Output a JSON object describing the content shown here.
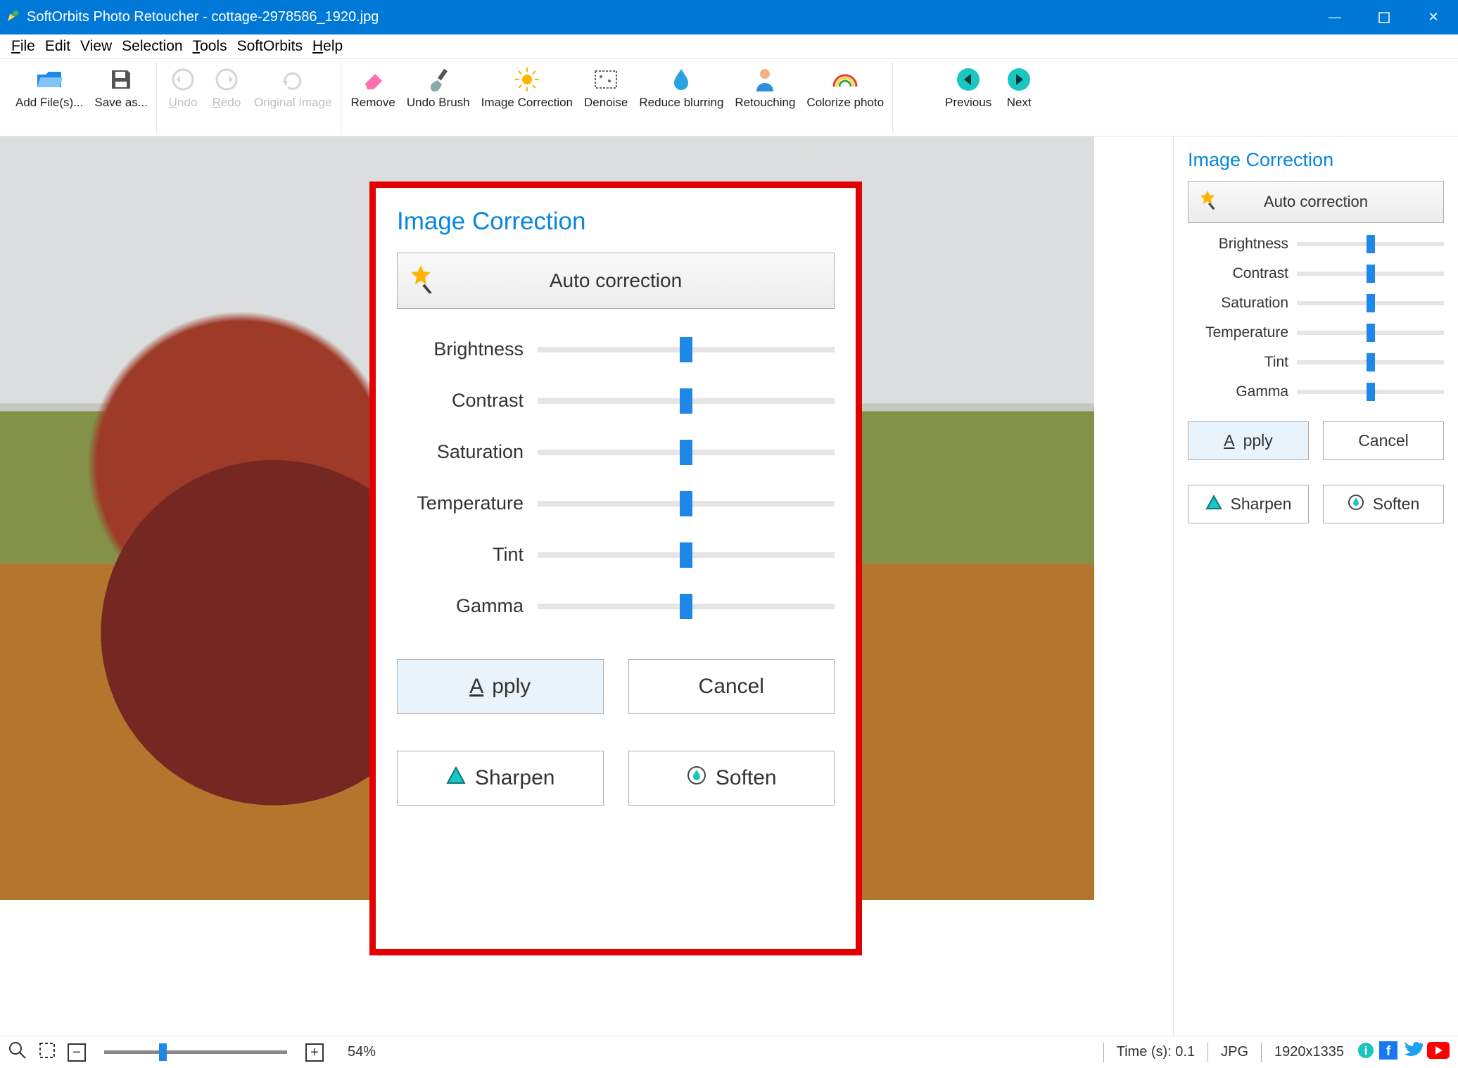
{
  "titlebar": {
    "app": "SoftOrbits Photo Retoucher",
    "file": "cottage-2978586_1920.jpg"
  },
  "menu": {
    "file": "File",
    "edit": "Edit",
    "view": "View",
    "selection": "Selection",
    "tools": "Tools",
    "softorbits": "SoftOrbits",
    "help": "Help"
  },
  "toolbar": {
    "add": "Add File(s)...",
    "save": "Save as...",
    "undo": "Undo",
    "redo": "Redo",
    "original": "Original Image",
    "remove": "Remove",
    "undobrush": "Undo Brush",
    "imagecorr": "Image Correction",
    "denoise": "Denoise",
    "reduceblur": "Reduce blurring",
    "retouch": "Retouching",
    "colorize": "Colorize photo",
    "previous": "Previous",
    "next": "Next"
  },
  "panel": {
    "title": "Image Correction",
    "auto": "Auto correction",
    "sliders": {
      "brightness": "Brightness",
      "contrast": "Contrast",
      "saturation": "Saturation",
      "temperature": "Temperature",
      "tint": "Tint",
      "gamma": "Gamma"
    },
    "apply": "Apply",
    "cancel": "Cancel",
    "sharpen": "Sharpen",
    "soften": "Soften"
  },
  "status": {
    "zoom": "54%",
    "time": "Time (s): 0.1",
    "format": "JPG",
    "dims": "1920x1335"
  }
}
